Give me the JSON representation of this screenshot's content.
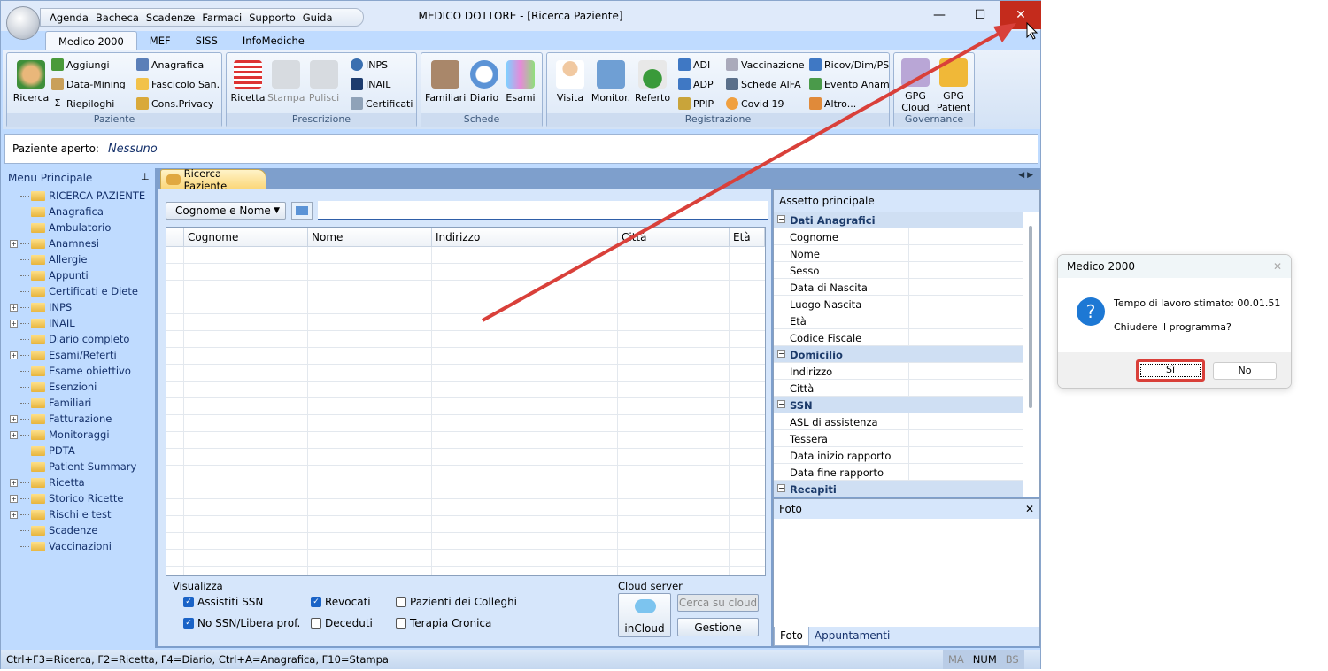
{
  "window": {
    "title": "MEDICO DOTTORE - [Ricerca Paziente]",
    "minimize": "—",
    "maximize": "☐",
    "close": "✕"
  },
  "qat": [
    "Agenda",
    "Bacheca",
    "Scadenze",
    "Farmaci",
    "Supporto",
    "Guida"
  ],
  "ribbon_tabs": [
    "Medico 2000",
    "MEF",
    "SISS",
    "InfoMediche"
  ],
  "ribbon": {
    "paziente": {
      "label": "Paziente",
      "ricerca": "Ricerca",
      "aggiungi": "Aggiungi",
      "datamining": "Data-Mining",
      "riepiloghi": "Riepiloghi",
      "anagrafica": "Anagrafica",
      "fascicolo": "Fascicolo San.",
      "privacy": "Cons.Privacy"
    },
    "prescrizione": {
      "label": "Prescrizione",
      "ricetta": "Ricetta",
      "stampa": "Stampa",
      "pulisci": "Pulisci",
      "inps": "INPS",
      "inail": "INAIL",
      "certificati": "Certificati"
    },
    "schede": {
      "label": "Schede",
      "familiari": "Familiari",
      "diario": "Diario",
      "esami": "Esami"
    },
    "registrazione": {
      "label": "Registrazione",
      "visita": "Visita",
      "monitor": "Monitor.",
      "referto": "Referto",
      "adi": "ADI",
      "adp": "ADP",
      "ppip": "PPIP",
      "vaccinazione": "Vaccinazione",
      "schede_aifa": "Schede AIFA",
      "covid": "Covid 19",
      "ricov": "Ricov/Dim/PS",
      "evento": "Evento Anam",
      "altro": "Altro..."
    },
    "governance": {
      "label": "Governance",
      "gpg_cloud": "GPG Cloud",
      "gpg_patient": "GPG Patient"
    }
  },
  "patient_bar": {
    "label": "Paziente aperto:",
    "value": "Nessuno"
  },
  "sidebar": {
    "title": "Menu Principale",
    "items": [
      {
        "label": "RICERCA PAZIENTE",
        "expandable": false
      },
      {
        "label": "Anagrafica",
        "expandable": false
      },
      {
        "label": "Ambulatorio",
        "expandable": false
      },
      {
        "label": "Anamnesi",
        "expandable": true
      },
      {
        "label": "Allergie",
        "expandable": false
      },
      {
        "label": "Appunti",
        "expandable": false
      },
      {
        "label": "Certificati e Diete",
        "expandable": false
      },
      {
        "label": "INPS",
        "expandable": true
      },
      {
        "label": "INAIL",
        "expandable": true
      },
      {
        "label": "Diario completo",
        "expandable": false
      },
      {
        "label": "Esami/Referti",
        "expandable": true
      },
      {
        "label": "Esame obiettivo",
        "expandable": false
      },
      {
        "label": "Esenzioni",
        "expandable": false
      },
      {
        "label": "Familiari",
        "expandable": false
      },
      {
        "label": "Fatturazione",
        "expandable": true
      },
      {
        "label": "Monitoraggi",
        "expandable": true
      },
      {
        "label": "PDTA",
        "expandable": false
      },
      {
        "label": "Patient Summary",
        "expandable": false
      },
      {
        "label": "Ricetta",
        "expandable": true
      },
      {
        "label": "Storico Ricette",
        "expandable": true
      },
      {
        "label": "Rischi e test",
        "expandable": true
      },
      {
        "label": "Scadenze",
        "expandable": false
      },
      {
        "label": "Vaccinazioni",
        "expandable": false
      }
    ]
  },
  "doc_tab": "Ricerca Paziente",
  "search": {
    "mode": "Cognome e Nome",
    "value": ""
  },
  "grid": {
    "columns": [
      "Cognome",
      "Nome",
      "Indirizzo",
      "Città",
      "Età"
    ],
    "rows": []
  },
  "visualizza": {
    "title": "Visualizza",
    "options": [
      {
        "label": "Assistiti SSN",
        "checked": true
      },
      {
        "label": "No SSN/Libera prof.",
        "checked": true
      },
      {
        "label": "Revocati",
        "checked": true
      },
      {
        "label": "Deceduti",
        "checked": false
      },
      {
        "label": "Pazienti dei Colleghi",
        "checked": false
      },
      {
        "label": "Terapia Cronica",
        "checked": false
      }
    ]
  },
  "cloud": {
    "title": "Cloud server",
    "incloud": "inCloud",
    "cerca": "Cerca su cloud",
    "gestione": "Gestione"
  },
  "assetto": {
    "title": "Assetto principale",
    "rows": [
      {
        "group": "Dati Anagrafici"
      },
      {
        "label": "Cognome"
      },
      {
        "label": "Nome"
      },
      {
        "label": "Sesso"
      },
      {
        "label": "Data di Nascita"
      },
      {
        "label": "Luogo Nascita"
      },
      {
        "label": "Età"
      },
      {
        "label": "Codice Fiscale"
      },
      {
        "group": "Domicilio"
      },
      {
        "label": "Indirizzo"
      },
      {
        "label": "Città"
      },
      {
        "group": "SSN"
      },
      {
        "label": "ASL di assistenza"
      },
      {
        "label": "Tessera"
      },
      {
        "label": "Data inizio rapporto"
      },
      {
        "label": "Data fine rapporto"
      },
      {
        "group": "Recapiti"
      }
    ]
  },
  "foto": {
    "title": "Foto",
    "tabs": [
      "Foto",
      "Appuntamenti"
    ]
  },
  "statusbar": {
    "text": "Ctrl+F3=Ricerca, F2=Ricetta, F4=Diario, Ctrl+A=Anagrafica, F10=Stampa",
    "indicators": [
      "MA",
      "NUM",
      "BS"
    ]
  },
  "dialog": {
    "title": "Medico 2000",
    "message": "Tempo di lavoro stimato: 00.01.51",
    "question": "Chiudere il programma?",
    "yes": "Sì",
    "no": "No"
  },
  "colors": {
    "annotation": "#d9403a",
    "accent": "#1a63c7",
    "close": "#c42b1c"
  }
}
